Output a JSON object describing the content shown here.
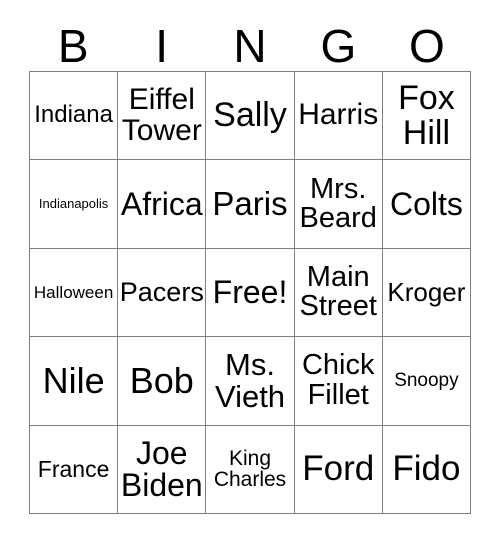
{
  "card": {
    "header": {
      "letters": [
        "B",
        "I",
        "N",
        "G",
        "O"
      ]
    },
    "grid": {
      "rows": [
        {
          "cells": [
            {
              "text": "Indiana",
              "font_size": 24
            },
            {
              "text": "Eiffel\nTower",
              "font_size": 30
            },
            {
              "text": "Sally",
              "font_size": 34
            },
            {
              "text": "Harris",
              "font_size": 30
            },
            {
              "text": "Fox\nHill",
              "font_size": 34
            }
          ]
        },
        {
          "cells": [
            {
              "text": "Indianapolis",
              "font_size": 13
            },
            {
              "text": "Africa",
              "font_size": 32
            },
            {
              "text": "Paris",
              "font_size": 33
            },
            {
              "text": "Mrs.\nBeard",
              "font_size": 29
            },
            {
              "text": "Colts",
              "font_size": 32
            }
          ]
        },
        {
          "cells": [
            {
              "text": "Halloween",
              "font_size": 17
            },
            {
              "text": "Pacers",
              "font_size": 27
            },
            {
              "text": "Free!",
              "font_size": 32
            },
            {
              "text": "Main\nStreet",
              "font_size": 29
            },
            {
              "text": "Kroger",
              "font_size": 26
            }
          ]
        },
        {
          "cells": [
            {
              "text": "Nile",
              "font_size": 36
            },
            {
              "text": "Bob",
              "font_size": 36
            },
            {
              "text": "Ms.\nVieth",
              "font_size": 31
            },
            {
              "text": "Chick\nFillet",
              "font_size": 29
            },
            {
              "text": "Snoopy",
              "font_size": 19
            }
          ]
        },
        {
          "cells": [
            {
              "text": "France",
              "font_size": 23
            },
            {
              "text": "Joe\nBiden",
              "font_size": 32
            },
            {
              "text": "King\nCharles",
              "font_size": 21
            },
            {
              "text": "Ford",
              "font_size": 35
            },
            {
              "text": "Fido",
              "font_size": 35
            }
          ]
        }
      ]
    },
    "colors": {
      "border": "#808080",
      "cell_background": "#ffffff",
      "text": "#000000",
      "page_background": "#ffffff"
    }
  }
}
